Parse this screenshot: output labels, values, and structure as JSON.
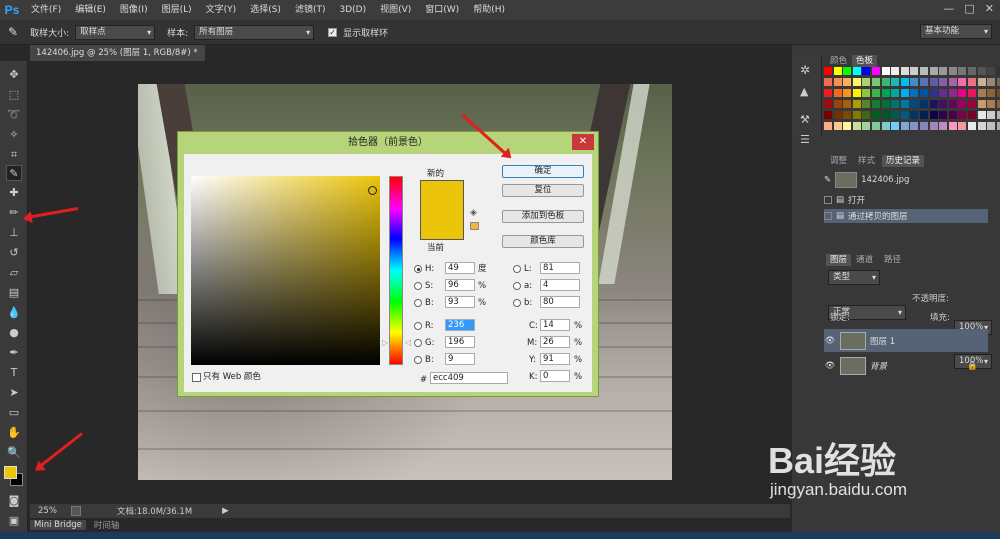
{
  "app": {
    "logo": "Ps"
  },
  "menu": [
    "文件(F)",
    "编辑(E)",
    "图像(I)",
    "图层(L)",
    "文字(Y)",
    "选择(S)",
    "滤镜(T)",
    "3D(D)",
    "视图(V)",
    "窗口(W)",
    "帮助(H)"
  ],
  "window_controls": [
    "—",
    "□",
    "✕"
  ],
  "options": {
    "sample_size_label": "取样大小:",
    "sample_size_value": "取样点",
    "sample_label": "样本:",
    "sample_value": "所有图层",
    "show_ring_label": "显示取样环",
    "workspace": "基本功能"
  },
  "document": {
    "tab_label": "142406.jpg @ 25% (图层 1, RGB/8#) *",
    "zoom": "25%",
    "doc_info": "文档:18.0M/36.1M"
  },
  "bottom_tabs": [
    "Mini Bridge",
    "时间轴"
  ],
  "panels": {
    "swatch_tabs": [
      "颜色",
      "色板"
    ],
    "history_tabs": [
      "调整",
      "样式",
      "历史记录"
    ],
    "history_file": "142406.jpg",
    "history_items": [
      "打开",
      "通过拷贝的图层"
    ],
    "layer_tabs": [
      "图层",
      "通道",
      "路径"
    ],
    "kind_label": "类型",
    "blend_mode": "正常",
    "opacity_label": "不透明度:",
    "opacity_value": "100%",
    "lock_label": "锁定:",
    "fill_label": "填充:",
    "fill_value": "100%",
    "layers": [
      "图层 1",
      "背景"
    ]
  },
  "dialog": {
    "title": "拾色器（前景色）",
    "new_label": "新的",
    "current_label": "当前",
    "buttons": {
      "ok": "确定",
      "reset": "复位",
      "add_swatch": "添加到色板",
      "libraries": "颜色库"
    },
    "web_only": "只有 Web 颜色",
    "fields": {
      "H": {
        "value": "49",
        "unit": "度"
      },
      "S": {
        "value": "96",
        "unit": "%"
      },
      "B": {
        "value": "93",
        "unit": "%"
      },
      "R": {
        "value": "236"
      },
      "G": {
        "value": "196"
      },
      "Bb": {
        "value": "9"
      },
      "L": {
        "value": "81"
      },
      "a": {
        "value": "4"
      },
      "b": {
        "value": "80"
      },
      "C": {
        "value": "14",
        "unit": "%"
      },
      "M": {
        "value": "26",
        "unit": "%"
      },
      "Y": {
        "value": "91",
        "unit": "%"
      },
      "K": {
        "value": "0",
        "unit": "%"
      }
    },
    "hex_label": "#",
    "hex": "ecc409",
    "new_color": "#ecc409",
    "current_color": "#ecc409"
  },
  "colors": {
    "foreground": "#ecc409",
    "background": "#000000"
  },
  "watermark": {
    "brand": "Bai经验",
    "url": "jingyan.baidu.com"
  }
}
